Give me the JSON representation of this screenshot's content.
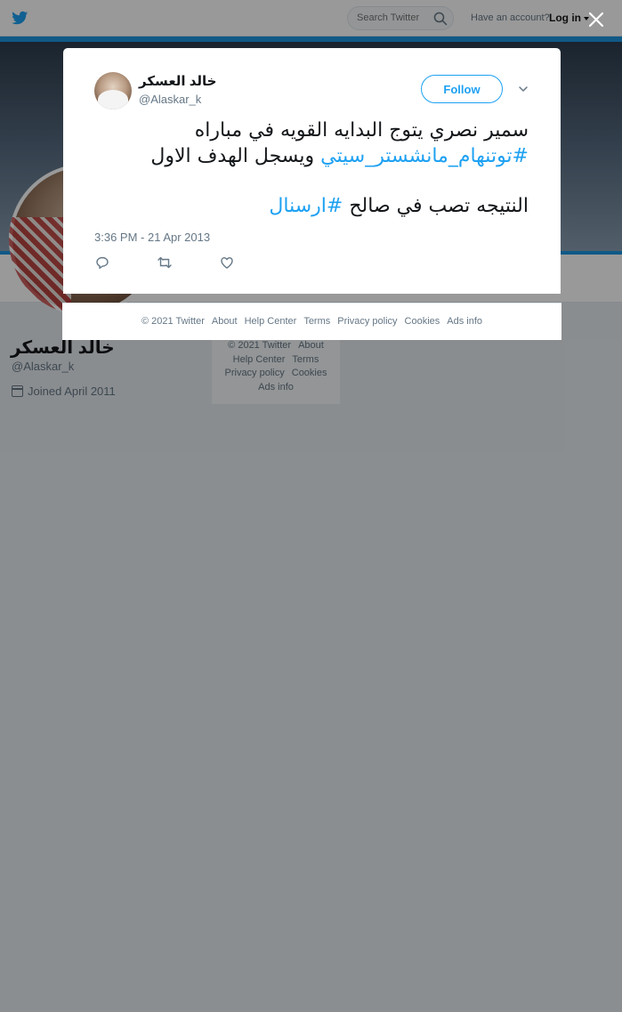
{
  "topbar": {
    "search_placeholder": "Search Twitter",
    "account_prompt": "Have an account?",
    "login_label": "Log in"
  },
  "profile": {
    "name": "خالد العسكر",
    "handle": "@Alaskar_k",
    "joined": "Joined April 2011"
  },
  "side_footer": {
    "links": [
      "© 2021 Twitter",
      "About",
      "Help Center",
      "Terms",
      "Privacy policy",
      "Cookies",
      "Ads info"
    ]
  },
  "tweet": {
    "author_name": "خالد العسكر",
    "author_handle": "@Alaskar_k",
    "follow_label": "Follow",
    "text_line1": "سمير نصري يتوج البدايه القويه في مباراه",
    "hashtag1": "#توتنهام_مانشستر_سيتي",
    "text_line2": " ويسجل الهدف الاول",
    "text_line3": "النتيجه تصب في صالح ",
    "hashtag2": "#ارسنال",
    "timestamp": "3:36 PM - 21 Apr 2013"
  },
  "modal_footer": {
    "links": [
      "© 2021 Twitter",
      "About",
      "Help Center",
      "Terms",
      "Privacy policy",
      "Cookies",
      "Ads info"
    ]
  },
  "colors": {
    "accent": "#1da1f2",
    "muted": "#657786",
    "text": "#14171a"
  }
}
